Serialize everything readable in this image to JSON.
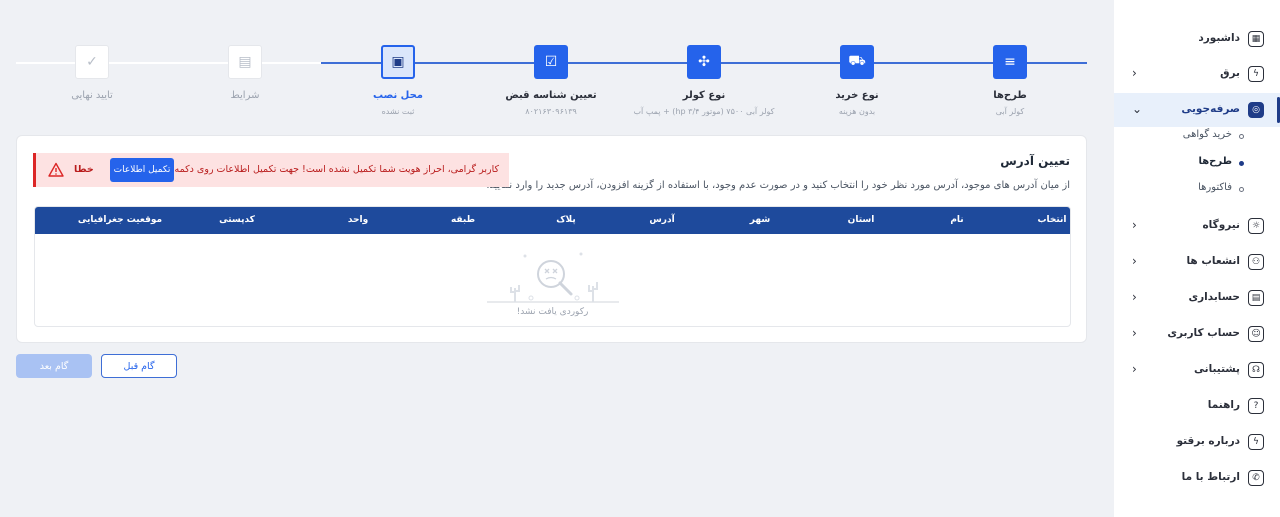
{
  "sidebar": {
    "items": [
      {
        "label": "داشبورد",
        "icon": "dashboard-icon",
        "glyph": "▦",
        "has_chevron": false
      },
      {
        "label": "برق",
        "icon": "electricity-icon",
        "glyph": "ϟ",
        "has_chevron": true
      },
      {
        "label": "صرفه‌جویی",
        "icon": "saving-icon",
        "glyph": "◎",
        "has_chevron": true,
        "active": true
      },
      {
        "label": "نیروگاه",
        "icon": "power-plant-icon",
        "glyph": "☼",
        "has_chevron": true
      },
      {
        "label": "انشعاب ها",
        "icon": "branch-icon",
        "glyph": "⚇",
        "has_chevron": true
      },
      {
        "label": "حسابداری",
        "icon": "accounting-icon",
        "glyph": "▤",
        "has_chevron": true
      },
      {
        "label": "حساب کاربری",
        "icon": "user-account-icon",
        "glyph": "☺",
        "has_chevron": true
      },
      {
        "label": "پشتیبانی",
        "icon": "support-icon",
        "glyph": "☊",
        "has_chevron": true
      },
      {
        "label": "راهنما",
        "icon": "help-icon",
        "glyph": "?",
        "has_chevron": false
      },
      {
        "label": "درباره برقتو",
        "icon": "about-icon",
        "glyph": "ϟ",
        "has_chevron": false
      },
      {
        "label": "ارتباط با ما",
        "icon": "phone-icon",
        "glyph": "✆",
        "has_chevron": false
      }
    ],
    "sub_items": [
      {
        "label": "خرید گواهی",
        "active": false
      },
      {
        "label": "طرح‌ها",
        "active": true
      },
      {
        "label": "فاکتورها",
        "active": false
      }
    ]
  },
  "stepper": {
    "steps": [
      {
        "title": "طرح‌ها",
        "subtitle": "کولر آبی",
        "state": "done",
        "icon": "plan-list-icon",
        "glyph": "≡"
      },
      {
        "title": "نوع خرید",
        "subtitle": "بدون هزینه",
        "state": "done",
        "icon": "cart-icon",
        "glyph": "⛟"
      },
      {
        "title": "نوع کولر",
        "subtitle": "کولر آبی ۷۵۰۰ (موتور ۳/۴ hp) + پمپ آب",
        "state": "done",
        "icon": "fan-icon",
        "glyph": "✣"
      },
      {
        "title": "تعیین شناسه قبض",
        "subtitle": "۸۰۲۱۶۳۰۹۶۱۳۹",
        "state": "done",
        "icon": "bill-id-icon",
        "glyph": "☑"
      },
      {
        "title": "محل نصب",
        "subtitle": "ثبت نشده",
        "state": "current",
        "icon": "location-card-icon",
        "glyph": "▣"
      },
      {
        "title": "شرایط",
        "subtitle": "",
        "state": "todo",
        "icon": "terms-icon",
        "glyph": "▤"
      },
      {
        "title": "تایید نهایی",
        "subtitle": "",
        "state": "todo",
        "icon": "check-circle-icon",
        "glyph": "✓"
      }
    ]
  },
  "address": {
    "title": "تعیین آدرس",
    "description": "از میان آدرس های موجود، آدرس مورد نظر خود را انتخاب کنید و در صورت عدم وجود، با استفاده از گزینه افزودن، آدرس جدید را وارد نمایید.",
    "alert": {
      "message": "کاربر گرامی، احراز هویت شما تکمیل نشده است! جهت تکمیل اطلاعات روی دکمه کلیک نمایید.",
      "button": "تکمیل اطلاعات",
      "error_label": "خطا",
      "color": "#dc2626"
    },
    "table": {
      "columns": [
        "انتخاب",
        "نام",
        "استان",
        "شهر",
        "آدرس",
        "پلاک",
        "طبقه",
        "واحد",
        "کدپستی",
        "موقعیت جغرافیایی"
      ],
      "rows": [],
      "empty_text": "رکوردی یافت نشد!"
    }
  },
  "footer": {
    "prev_label": "گام قبل",
    "next_label": "گام بعد"
  },
  "colors": {
    "primary": "#2563eb",
    "header": "#1e4a9c",
    "error": "#dc2626"
  }
}
